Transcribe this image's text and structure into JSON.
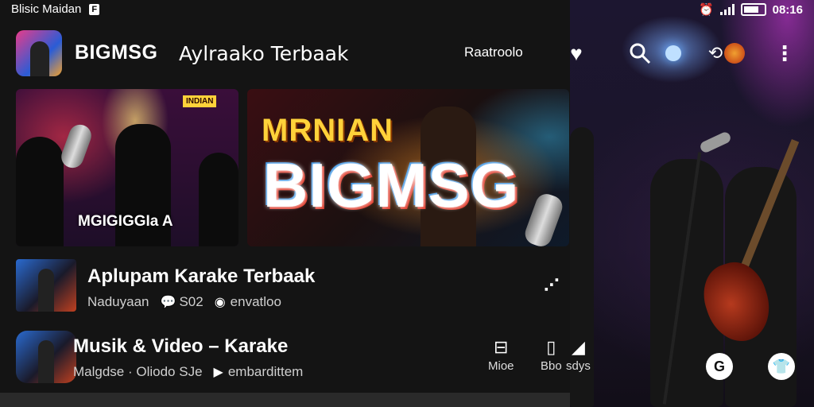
{
  "status": {
    "app_label": "Blisic Maidan",
    "badge": "F",
    "time": "08:16"
  },
  "header": {
    "channel_name": "BIGMSG",
    "tagline": "Aylraakᴏ Terbaak",
    "link": "Raatroolo",
    "icons": [
      "heart-icon",
      "search-icon",
      "light-icon",
      "cast-icon",
      "more-icon"
    ]
  },
  "thumbnails": [
    {
      "badge": "INDIAN",
      "caption": "MGIGIGGIa A"
    },
    {
      "top_text": "MRNIAN",
      "big_text": "BIGMSG"
    }
  ],
  "rows": [
    {
      "title": "Aplupam Karake Terbaak",
      "meta": [
        "Naduyaan",
        "S02",
        "envatloo"
      ],
      "meta_icons": [
        "chat-icon",
        "circle-icon"
      ]
    },
    {
      "title": "Musik & Video – Karake",
      "meta": [
        "Malgdse · Oliodo SJe",
        "embardittem"
      ],
      "meta_icons": [
        "play-icon"
      ],
      "actions": [
        {
          "label": "Mioe",
          "icon": "lock-icon"
        },
        {
          "label": "Bbo",
          "icon": "phone-icon"
        },
        {
          "label": "sdys",
          "icon": "flame-icon"
        }
      ]
    }
  ],
  "colors": {
    "panel": "#141414",
    "accent": "#e03a2a"
  }
}
